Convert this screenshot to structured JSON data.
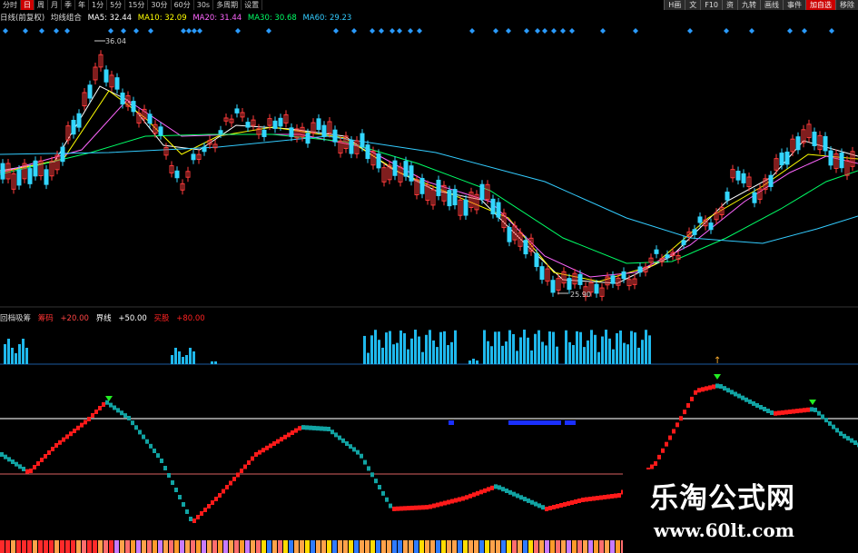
{
  "toolbar": {
    "left_buttons": [
      "分时",
      "日",
      "周",
      "月",
      "季",
      "年",
      "1分",
      "5分",
      "15分",
      "30分",
      "60分",
      "30s",
      "多周期",
      "设置"
    ],
    "active_index": 1,
    "right_buttons": [
      "H画",
      "文",
      "F10",
      "资",
      "九转",
      "画线",
      "事件",
      "加自选",
      "移除"
    ],
    "highlight_right_index": 7
  },
  "ma_line": {
    "period_label": "日线(前复权)",
    "indicator_name": "均线组合",
    "ma5": {
      "text": "MA5: 32.44",
      "color": "#ffffff"
    },
    "ma10": {
      "text": "MA10: 32.09",
      "color": "#ffff00"
    },
    "ma20": {
      "text": "MA20: 31.44",
      "color": "#ff66ff"
    },
    "ma30": {
      "text": "MA30: 30.68",
      "color": "#00ff66"
    },
    "ma60": {
      "text": "MA60: 29.23",
      "color": "#33ccff"
    }
  },
  "price_labels": {
    "high": "36.04",
    "low": "25.90"
  },
  "indicator_header": {
    "name": "回档吸筹",
    "item1": {
      "text": "筹码",
      "color": "#ff3333"
    },
    "item2": {
      "text": "+20.00",
      "color": "#ff4444"
    },
    "item3": {
      "text": "界线",
      "color": "#ffffff"
    },
    "item4": {
      "text": "+50.00",
      "color": "#ffffff"
    },
    "item5": {
      "text": "买股",
      "color": "#ff2222"
    },
    "item6": {
      "text": "+80.00",
      "color": "#ff2222"
    }
  },
  "colors": {
    "up": "#ff3b3b",
    "down": "#33d6ff",
    "osc_up": "#ff1a1a",
    "osc_down": "#11a3a3",
    "hist": "#1fb8ec",
    "marker": "#22ee22"
  },
  "watermark": {
    "title": "乐淘公式网",
    "url": "www.60lt.com"
  }
}
